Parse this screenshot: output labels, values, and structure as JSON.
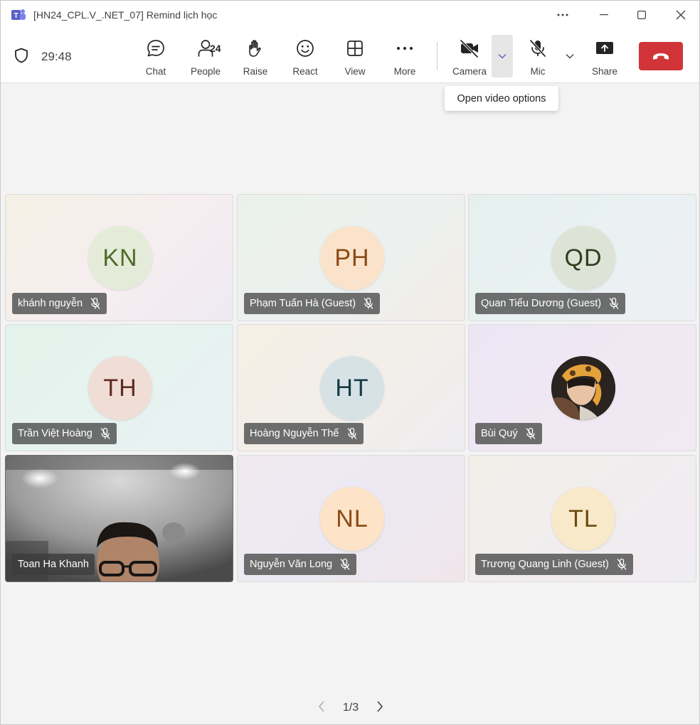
{
  "window": {
    "title": "[HN24_CPL.V_.NET_07] Remind lịch học"
  },
  "toolbar": {
    "timer": "29:48",
    "chat_label": "Chat",
    "people_label": "People",
    "people_count": "24",
    "raise_label": "Raise",
    "react_label": "React",
    "view_label": "View",
    "more_label": "More",
    "camera_label": "Camera",
    "mic_label": "Mic",
    "share_label": "Share"
  },
  "tooltip": {
    "text": "Open video options"
  },
  "colors": {
    "leave": "#d13438",
    "toolbar_bg": "#ffffff",
    "stage_bg": "#f3f3f3"
  },
  "participants": [
    {
      "initials": "KN",
      "name": "khánh nguyễn",
      "muted": true,
      "avatar_bg": "#e4ecd9",
      "avatar_fg": "#4f6b2c"
    },
    {
      "initials": "PH",
      "name": "Phạm Tuấn Hà (Guest)",
      "muted": true,
      "avatar_bg": "#fbe3cb",
      "avatar_fg": "#8a4a14"
    },
    {
      "initials": "QD",
      "name": "Quan Tiểu Dương (Guest)",
      "muted": true,
      "avatar_bg": "#dde3d6",
      "avatar_fg": "#2e3f20"
    },
    {
      "initials": "TH",
      "name": "Trần Việt Hoàng",
      "muted": true,
      "avatar_bg": "#f0ddd6",
      "avatar_fg": "#5b2d1e"
    },
    {
      "initials": "HT",
      "name": "Hoàng Nguyễn Thế",
      "muted": true,
      "avatar_bg": "#d6e2e6",
      "avatar_fg": "#163a44"
    },
    {
      "initials": "",
      "name": "Bùi Quý",
      "muted": true,
      "photo": true
    },
    {
      "initials": "",
      "name": "Toan Ha Khanh",
      "muted": false,
      "video": true
    },
    {
      "initials": "NL",
      "name": "Nguyễn Văn Long",
      "muted": true,
      "avatar_bg": "#fde3c8",
      "avatar_fg": "#8b4a12"
    },
    {
      "initials": "TL",
      "name": "Trương Quang Linh (Guest)",
      "muted": true,
      "avatar_bg": "#f7e9c9",
      "avatar_fg": "#6b4a10"
    }
  ],
  "pager": {
    "text": "1/3"
  }
}
